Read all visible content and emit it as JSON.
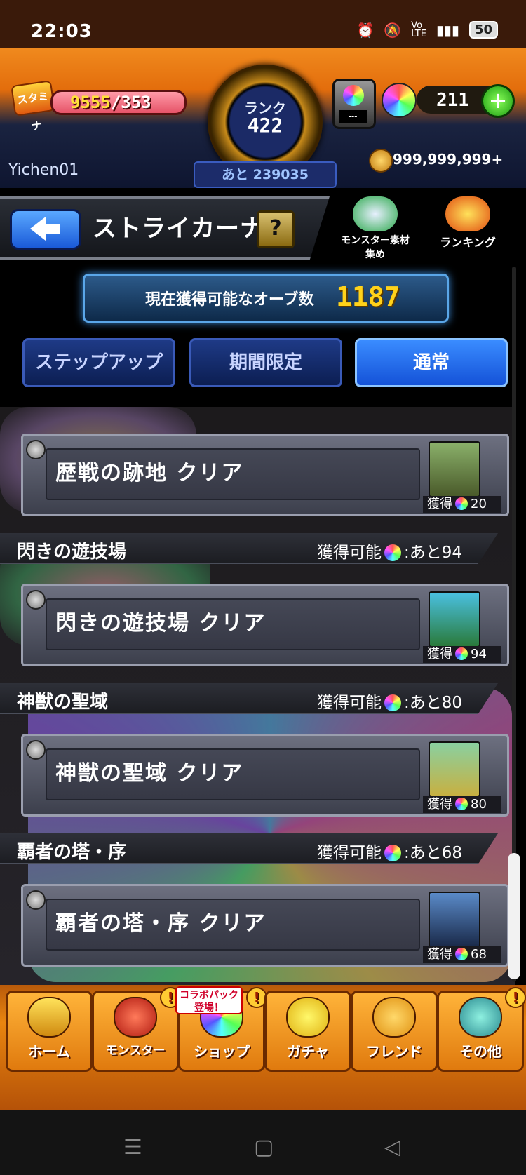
{
  "status": {
    "time": "22:03",
    "icons": [
      "alarm-icon",
      "mute-icon",
      "volte-icon",
      "signal-icon"
    ],
    "battery": "50"
  },
  "hud": {
    "stamina_label": "スタミナ",
    "stamina_current": "9555",
    "stamina_max": "/353",
    "rank_label": "ランク",
    "rank_value": "422",
    "rank_remaining": "あと 239035",
    "player_name": "Yichen01",
    "box_screen": "---",
    "orb_count": "211",
    "gold": "999,999,999+"
  },
  "nav": {
    "title": "ストライカーナビ",
    "help": "?",
    "material_button": "モンスター素材集め",
    "ranking_button": "ランキング"
  },
  "banner": {
    "text": "現在獲得可能なオーブ数",
    "count": "1187"
  },
  "tabs": [
    {
      "label": "ステップアップ",
      "active": false
    },
    {
      "label": "期間限定",
      "active": false
    },
    {
      "label": "通常",
      "active": true
    }
  ],
  "list": {
    "cards": [
      {
        "label": "歴戦の跡地 クリア",
        "gain_label": "獲得",
        "gain": "20"
      },
      {
        "label": "閃きの遊技場 クリア",
        "gain_label": "獲得",
        "gain": "94"
      },
      {
        "label": "神獣の聖域 クリア",
        "gain_label": "獲得",
        "gain": "80"
      },
      {
        "label": "覇者の塔・序 クリア",
        "gain_label": "獲得",
        "gain": "68"
      }
    ],
    "sections": [
      {
        "name": "閃きの遊技場",
        "avail_label": "獲得可能",
        "avail": ":あと94"
      },
      {
        "name": "神獣の聖域",
        "avail_label": "獲得可能",
        "avail": ":あと80"
      },
      {
        "name": "覇者の塔・序",
        "avail_label": "獲得可能",
        "avail": ":あと68"
      }
    ]
  },
  "bottom_nav": [
    {
      "label": "ホーム",
      "alert": ""
    },
    {
      "label": "モンスター",
      "alert": "!"
    },
    {
      "label": "ショップ",
      "alert": "!"
    },
    {
      "label": "ガチャ",
      "alert": ""
    },
    {
      "label": "フレンド",
      "alert": ""
    },
    {
      "label": "その他",
      "alert": "!"
    }
  ],
  "collab_badge": "コラボパック登場！",
  "system_nav": {
    "menu": "☰",
    "home": "▢",
    "back": "◁"
  },
  "colors": {
    "accent_orange": "#e9850f",
    "tab_active": "#1452d8",
    "orb_count": "#ffd21a",
    "stamina": "#e65468"
  }
}
